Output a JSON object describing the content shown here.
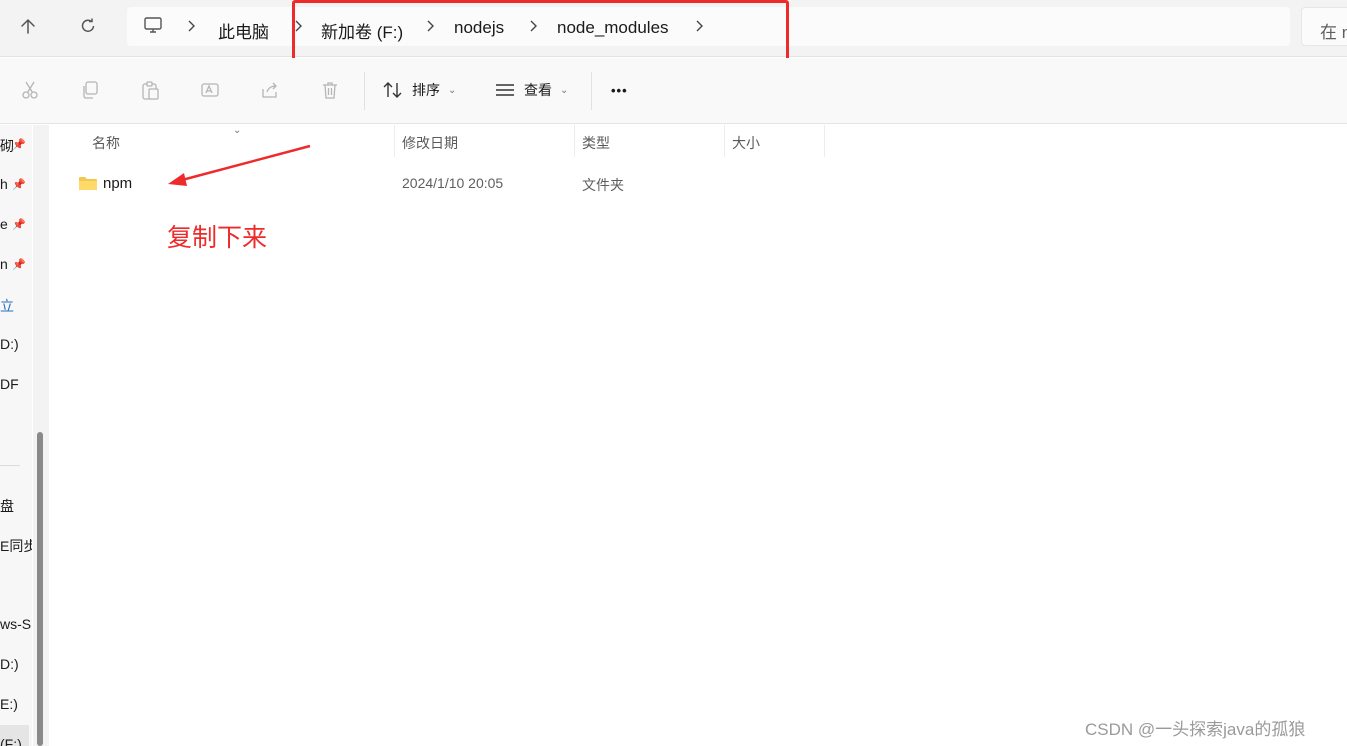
{
  "address_bar": {
    "breadcrumbs": [
      "此电脑",
      "新加卷 (F:)",
      "nodejs",
      "node_modules"
    ],
    "search_placeholder": "在 n"
  },
  "toolbar": {
    "sort_label": "排序",
    "view_label": "查看",
    "more_label": "•••"
  },
  "sidebar": {
    "items": [
      "砌",
      "h",
      "e",
      "n",
      "立",
      "D:)",
      "DF",
      "盘",
      "E同步",
      "ws-S",
      "D:)",
      "E:)",
      "(F:)"
    ]
  },
  "file_list": {
    "columns": [
      "名称",
      "修改日期",
      "类型",
      "大小"
    ],
    "rows": [
      {
        "name": "npm",
        "modified": "2024/1/10 20:05",
        "type": "文件夹",
        "size": ""
      }
    ]
  },
  "annotation": {
    "text": "复制下来",
    "color": "#ee2b2b"
  },
  "watermark": "CSDN @一头探索java的孤狼"
}
